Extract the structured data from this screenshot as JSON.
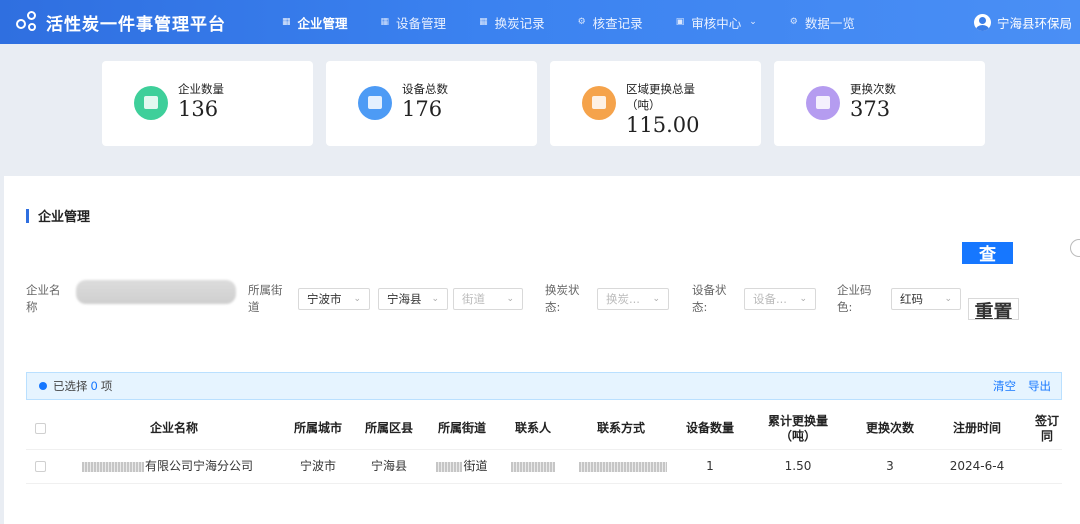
{
  "app": {
    "title": "活性炭一件事管理平台"
  },
  "nav": [
    {
      "label": "企业管理",
      "icon": "grid-icon",
      "active": true
    },
    {
      "label": "设备管理",
      "icon": "grid-icon"
    },
    {
      "label": "换炭记录",
      "icon": "grid-icon"
    },
    {
      "label": "核查记录",
      "icon": "gear-icon"
    },
    {
      "label": "审核中心",
      "icon": "monitor-icon",
      "dropdown": true
    },
    {
      "label": "数据一览",
      "icon": "gear-icon"
    }
  ],
  "user": {
    "name": "宁海县环保局"
  },
  "stats": [
    {
      "label": "企业数量",
      "value": "136",
      "color": "#3ecf9a"
    },
    {
      "label": "设备总数",
      "value": "176",
      "color": "#4d9bf5"
    },
    {
      "label": "区域更换总量",
      "label2": "（吨）",
      "value": "115.00",
      "color": "#f5a34b"
    },
    {
      "label": "更换次数",
      "value": "373",
      "color": "#b59cf0"
    }
  ],
  "section": {
    "title": "企业管理"
  },
  "buttons": {
    "query": "查",
    "reset": "重置"
  },
  "filters": {
    "company_label": "企业名称",
    "street_label": "所属街道",
    "city": "宁波市",
    "county": "宁海县",
    "street_placeholder": "街道",
    "carbon_status_label": "换炭状态:",
    "carbon_status_placeholder": "换炭...",
    "device_status_label": "设备状态:",
    "device_status_placeholder": "设备...",
    "code_color_label": "企业码色:",
    "code_color_value": "红码"
  },
  "selection": {
    "prefix": "已选择",
    "count": "0",
    "suffix": "项",
    "clear": "清空",
    "export": "导出"
  },
  "table": {
    "headers": [
      "企业名称",
      "所属城市",
      "所属区县",
      "所属街道",
      "联系人",
      "联系方式",
      "设备数量",
      "累计更换量（吨）",
      "更换次数",
      "注册时间",
      "签订同"
    ],
    "rows": [
      {
        "company": "有限公司宁海分公司",
        "city": "宁波市",
        "county": "宁海县",
        "street": "街道",
        "devices": "1",
        "total": "1.50",
        "times": "3",
        "date": "2024-6-4"
      }
    ]
  },
  "colors": {
    "primary": "#1677ff",
    "topbar": "#3b7ee8"
  }
}
